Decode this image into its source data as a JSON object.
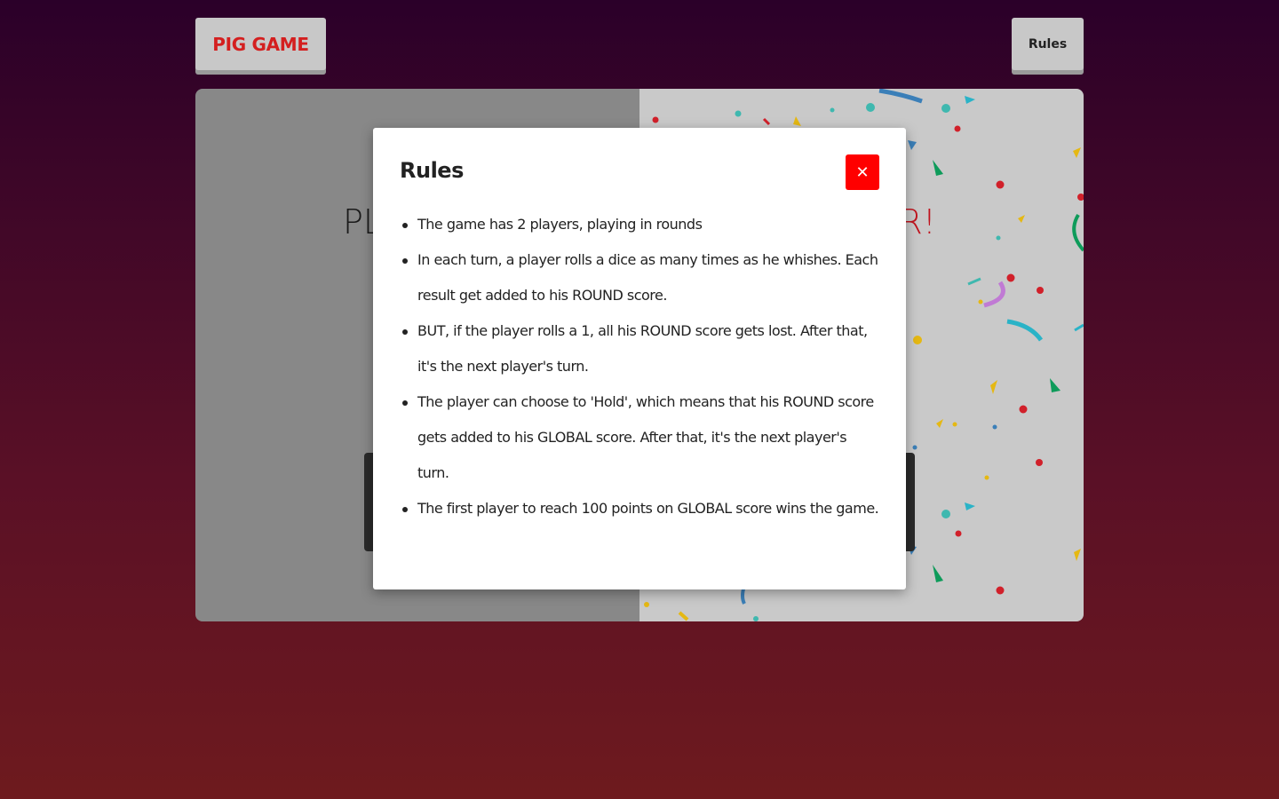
{
  "header": {
    "logo_label": "PIG GAME",
    "rules_label": "Rules"
  },
  "board": {
    "player1_name_visible": "PL",
    "player2_name_visible": "R!"
  },
  "modal": {
    "title": "Rules",
    "close_label": "✕",
    "items": [
      "The game has 2 players, playing in rounds",
      "In each turn, a player rolls a dice as many times as he whishes. Each result get added to his ROUND score.",
      "BUT, if the player rolls a 1, all his ROUND score gets lost. After that, it's the next player's turn.",
      "The player can choose to 'Hold', which means that his ROUND score gets added to his GLOBAL score. After that, it's the next player's turn.",
      "The first player to reach 100 points on GLOBAL score wins the game."
    ]
  },
  "colors": {
    "accent_red": "#d41f1f",
    "close_red": "#ff0000",
    "winner_red": "#c0141e"
  }
}
